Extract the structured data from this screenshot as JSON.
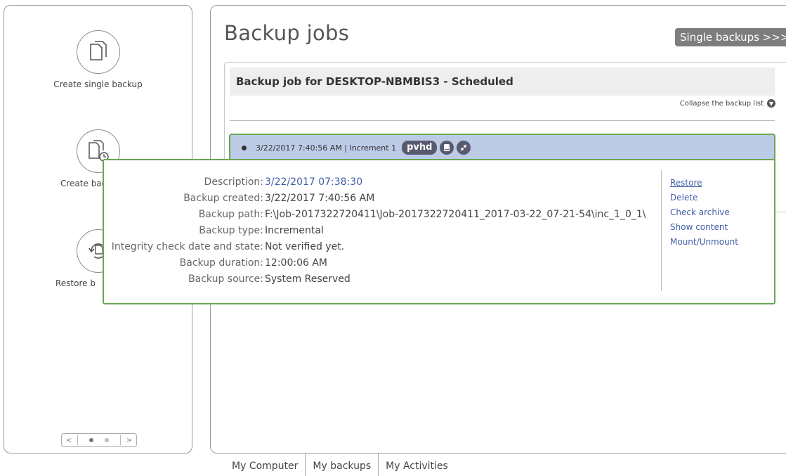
{
  "sidebar": {
    "actions": [
      {
        "label": "Create single backup",
        "icon": "single-backup-icon"
      },
      {
        "label": "Create bac",
        "icon": "scheduled-backup-icon"
      },
      {
        "label": "Restore b",
        "icon": "restore-icon"
      }
    ],
    "pager": {
      "left": "<",
      "right": ">"
    }
  },
  "main": {
    "title": "Backup jobs",
    "single_backups_button": "Single backups >>>",
    "job": {
      "header": "Backup job for DESKTOP-NBMBIS3 - Scheduled",
      "collapse_label": "Collapse the backup list"
    },
    "backup_row": {
      "text": "3/22/2017 7:40:56 AM | Increment 1",
      "badge": "pvhd",
      "icons": [
        "disk-icon",
        "shrink-icon"
      ]
    }
  },
  "detail": {
    "rows": [
      {
        "key": "Description:",
        "value": "3/22/2017 07:38:30"
      },
      {
        "key": "Backup created:",
        "value": "3/22/2017 7:40:56 AM"
      },
      {
        "key": "Backup path:",
        "value": "F:\\Job-2017322720411\\Job-2017322720411_2017-03-22_07-21-54\\inc_1_0_1\\"
      },
      {
        "key": "Backup type:",
        "value": "Incremental"
      },
      {
        "key": "Integrity check date and state:",
        "value": "Not verified yet."
      },
      {
        "key": "Backup duration:",
        "value": "12:00:06 AM"
      },
      {
        "key": "Backup source:",
        "value": "System Reserved"
      }
    ],
    "actions": [
      "Restore",
      "Delete",
      "Check archive",
      "Show content",
      "Mount/Unmount"
    ]
  },
  "tabs": [
    "My Computer",
    "My backups",
    "My Activities"
  ],
  "colors": {
    "highlight_border": "#6aa84f",
    "row_bg": "#bccbe6",
    "link": "#3f5fa6"
  }
}
